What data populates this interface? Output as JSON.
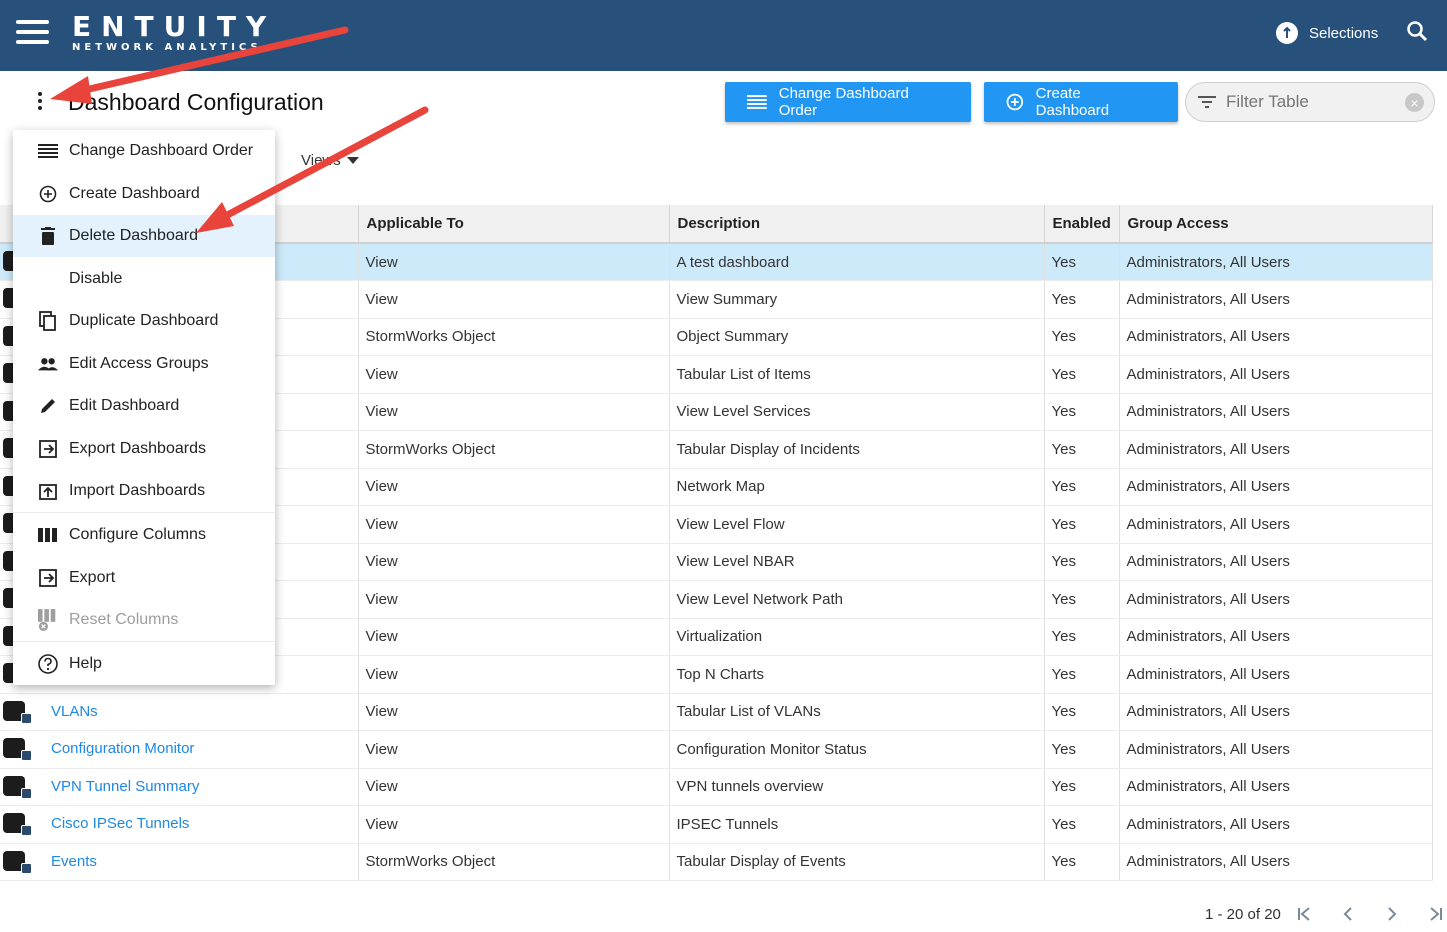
{
  "header": {
    "brand": "ENTUITY",
    "tagline": "NETWORK ANALYTICS",
    "selections_label": "Selections"
  },
  "page": {
    "title": "Dashboard Configuration",
    "change_order_label": "Change Dashboard Order",
    "create_label": "Create Dashboard",
    "filter_placeholder": "Filter Table",
    "views_label": "Views"
  },
  "menu": {
    "items": [
      {
        "label": "Change Dashboard Order",
        "icon": "list-icon"
      },
      {
        "label": "Create Dashboard",
        "icon": "add-circle-icon"
      },
      {
        "label": "Delete Dashboard",
        "icon": "trash-icon"
      },
      {
        "label": "Disable",
        "icon": ""
      },
      {
        "label": "Duplicate Dashboard",
        "icon": "copy-icon"
      },
      {
        "label": "Edit Access Groups",
        "icon": "people-icon"
      },
      {
        "label": "Edit Dashboard",
        "icon": "pencil-icon"
      },
      {
        "label": "Export Dashboards",
        "icon": "export-icon"
      },
      {
        "label": "Import Dashboards",
        "icon": "import-icon"
      },
      {
        "label": "Configure Columns",
        "icon": "columns-icon"
      },
      {
        "label": "Export",
        "icon": "export-icon"
      },
      {
        "label": "Reset Columns",
        "icon": "reset-columns-icon"
      },
      {
        "label": "Help",
        "icon": "help-icon"
      }
    ]
  },
  "table": {
    "columns": [
      "",
      "Applicable To",
      "Description",
      "Enabled",
      "Group Access"
    ],
    "rows": [
      {
        "name": "",
        "applicable": "View",
        "description": "A test dashboard",
        "enabled": "Yes",
        "access": "Administrators, All Users"
      },
      {
        "name": "",
        "applicable": "View",
        "description": "View Summary",
        "enabled": "Yes",
        "access": "Administrators, All Users"
      },
      {
        "name": "",
        "applicable": "StormWorks Object",
        "description": "Object Summary",
        "enabled": "Yes",
        "access": "Administrators, All Users"
      },
      {
        "name": "",
        "applicable": "View",
        "description": "Tabular List of Items",
        "enabled": "Yes",
        "access": "Administrators, All Users"
      },
      {
        "name": "",
        "applicable": "View",
        "description": "View Level Services",
        "enabled": "Yes",
        "access": "Administrators, All Users"
      },
      {
        "name": "",
        "applicable": "StormWorks Object",
        "description": "Tabular Display of Incidents",
        "enabled": "Yes",
        "access": "Administrators, All Users"
      },
      {
        "name": "",
        "applicable": "View",
        "description": "Network Map",
        "enabled": "Yes",
        "access": "Administrators, All Users"
      },
      {
        "name": "",
        "applicable": "View",
        "description": "View Level Flow",
        "enabled": "Yes",
        "access": "Administrators, All Users"
      },
      {
        "name": "",
        "applicable": "View",
        "description": "View Level NBAR",
        "enabled": "Yes",
        "access": "Administrators, All Users"
      },
      {
        "name": "",
        "applicable": "View",
        "description": "View Level Network Path",
        "enabled": "Yes",
        "access": "Administrators, All Users"
      },
      {
        "name": "",
        "applicable": "View",
        "description": "Virtualization",
        "enabled": "Yes",
        "access": "Administrators, All Users"
      },
      {
        "name": "",
        "applicable": "View",
        "description": "Top N Charts",
        "enabled": "Yes",
        "access": "Administrators, All Users"
      },
      {
        "name": "VLANs",
        "applicable": "View",
        "description": "Tabular List of VLANs",
        "enabled": "Yes",
        "access": "Administrators, All Users"
      },
      {
        "name": "Configuration Monitor",
        "applicable": "View",
        "description": "Configuration Monitor Status",
        "enabled": "Yes",
        "access": "Administrators, All Users"
      },
      {
        "name": "VPN Tunnel Summary",
        "applicable": "View",
        "description": "VPN tunnels overview",
        "enabled": "Yes",
        "access": "Administrators, All Users"
      },
      {
        "name": "Cisco IPSec Tunnels",
        "applicable": "View",
        "description": "IPSEC Tunnels",
        "enabled": "Yes",
        "access": "Administrators, All Users"
      },
      {
        "name": "Events",
        "applicable": "StormWorks Object",
        "description": "Tabular Display of Events",
        "enabled": "Yes",
        "access": "Administrators, All Users"
      }
    ]
  },
  "pager": {
    "range": "1 - 20 of 20"
  },
  "colors": {
    "topbar": "#27517b",
    "button": "#2196f3",
    "selected_row": "#cdeafb",
    "link": "#1e88e5",
    "annotation_arrow": "#e8443c"
  }
}
